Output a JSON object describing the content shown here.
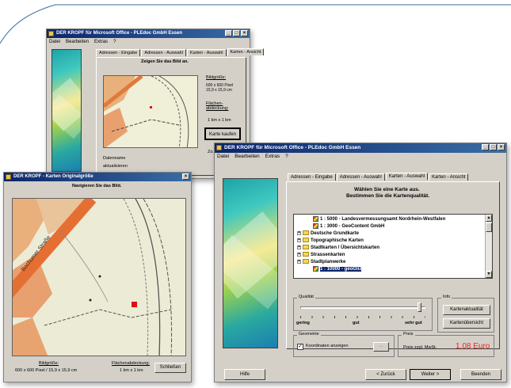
{
  "back_window": {
    "title": "DER KROPF für Microsoft Office - PLEdoc GmbH Essen",
    "menu": [
      "Datei",
      "Bearbeiten",
      "Extras",
      "?"
    ],
    "tabs": [
      "Adressen - Eingabe",
      "Adressen - Auswahl",
      "Karten - Auswahl",
      "Karten - Ansicht"
    ],
    "heading": "Zeigen Sie das Bild an.",
    "bildgroesse_label": "Bildgröße:",
    "bildgroesse_value": "600 x 600 Pixel 15,9 x 15,9 cm",
    "flaechen_label": "Flächen-abdeckung:",
    "flaechen_value": "1 km x 1 km",
    "kaufen_button": "Karte kaufen",
    "zoom_label": "Zo...",
    "datenname_label": "Datenname",
    "aktualisierung_label": "aktualisieren"
  },
  "left_window": {
    "title": "DER KROPF - Karten Originalgröße",
    "heading": "Navigieren Sie das Bild.",
    "street_label": "Bochumer Straße",
    "bildgroesse_label": "Bildgröße:",
    "bildgroesse_value": "600 x 600 Pixel / 15,9 x 15,9 cm",
    "flaechen_label": "Flächenabdeckung:",
    "flaechen_value": "1 km x 1 km",
    "schliessen_button": "Schließen"
  },
  "main_window": {
    "title": "DER KROPF für Microsoft Office - PLEdoc GmbH Essen",
    "menu": [
      "Datei",
      "Bearbeiten",
      "Extras",
      "?"
    ],
    "tabs": [
      "Adressen - Eingabe",
      "Adressen - Auswahl",
      "Karten - Auswahl",
      "Karten - Ansicht"
    ],
    "heading_line1": "Wählen Sie eine Karte aus.",
    "heading_line2": "Bestimmen Sie die Kartenqualität.",
    "tree_items": [
      {
        "text": "1 : 5000 - Landesvermessungsamt Nordrhein-Westfalen",
        "type": "map",
        "indent": 2
      },
      {
        "text": "1 : 3000 - GeoContent GmbH",
        "type": "map",
        "indent": 2
      },
      {
        "text": "Deutsche Grundkarte",
        "type": "folder",
        "indent": 0
      },
      {
        "text": "Topographische Karten",
        "type": "folder",
        "indent": 0
      },
      {
        "text": "Stadtkarten / Übersichtskarten",
        "type": "folder",
        "indent": 0
      },
      {
        "text": "Strassenkarten",
        "type": "folder",
        "indent": 0
      },
      {
        "text": "Stadtplanwerke",
        "type": "folder",
        "indent": 0
      },
      {
        "text": "1 : 10000 - geoGliz",
        "type": "map-selected",
        "indent": 2
      }
    ],
    "quality_group": "Qualität",
    "quality_levels": [
      "gering",
      "gut",
      "sehr gut"
    ],
    "quality_value_fraction": 0.97,
    "info_group": "Info",
    "info_button_1": "Kartenaktualität",
    "info_button_2": "Kartenübersicht",
    "geometrie_group": "Geometrie",
    "koordinaten_label": "Koordinaten anzeigen",
    "dots_button": "...",
    "preis_group": "Preis",
    "preis_label": "Preis zzgl. MwSt.",
    "preis_value": "1,08 Euro",
    "buttons": {
      "hilfe": "Hilfe",
      "zurueck": "< Zurück",
      "weiter": "Weiter >",
      "beenden": "Beenden"
    }
  },
  "colors": {
    "title_bar": "#0a246a",
    "dialog_bg": "#d4d0c8",
    "price": "#ff1a1a"
  }
}
